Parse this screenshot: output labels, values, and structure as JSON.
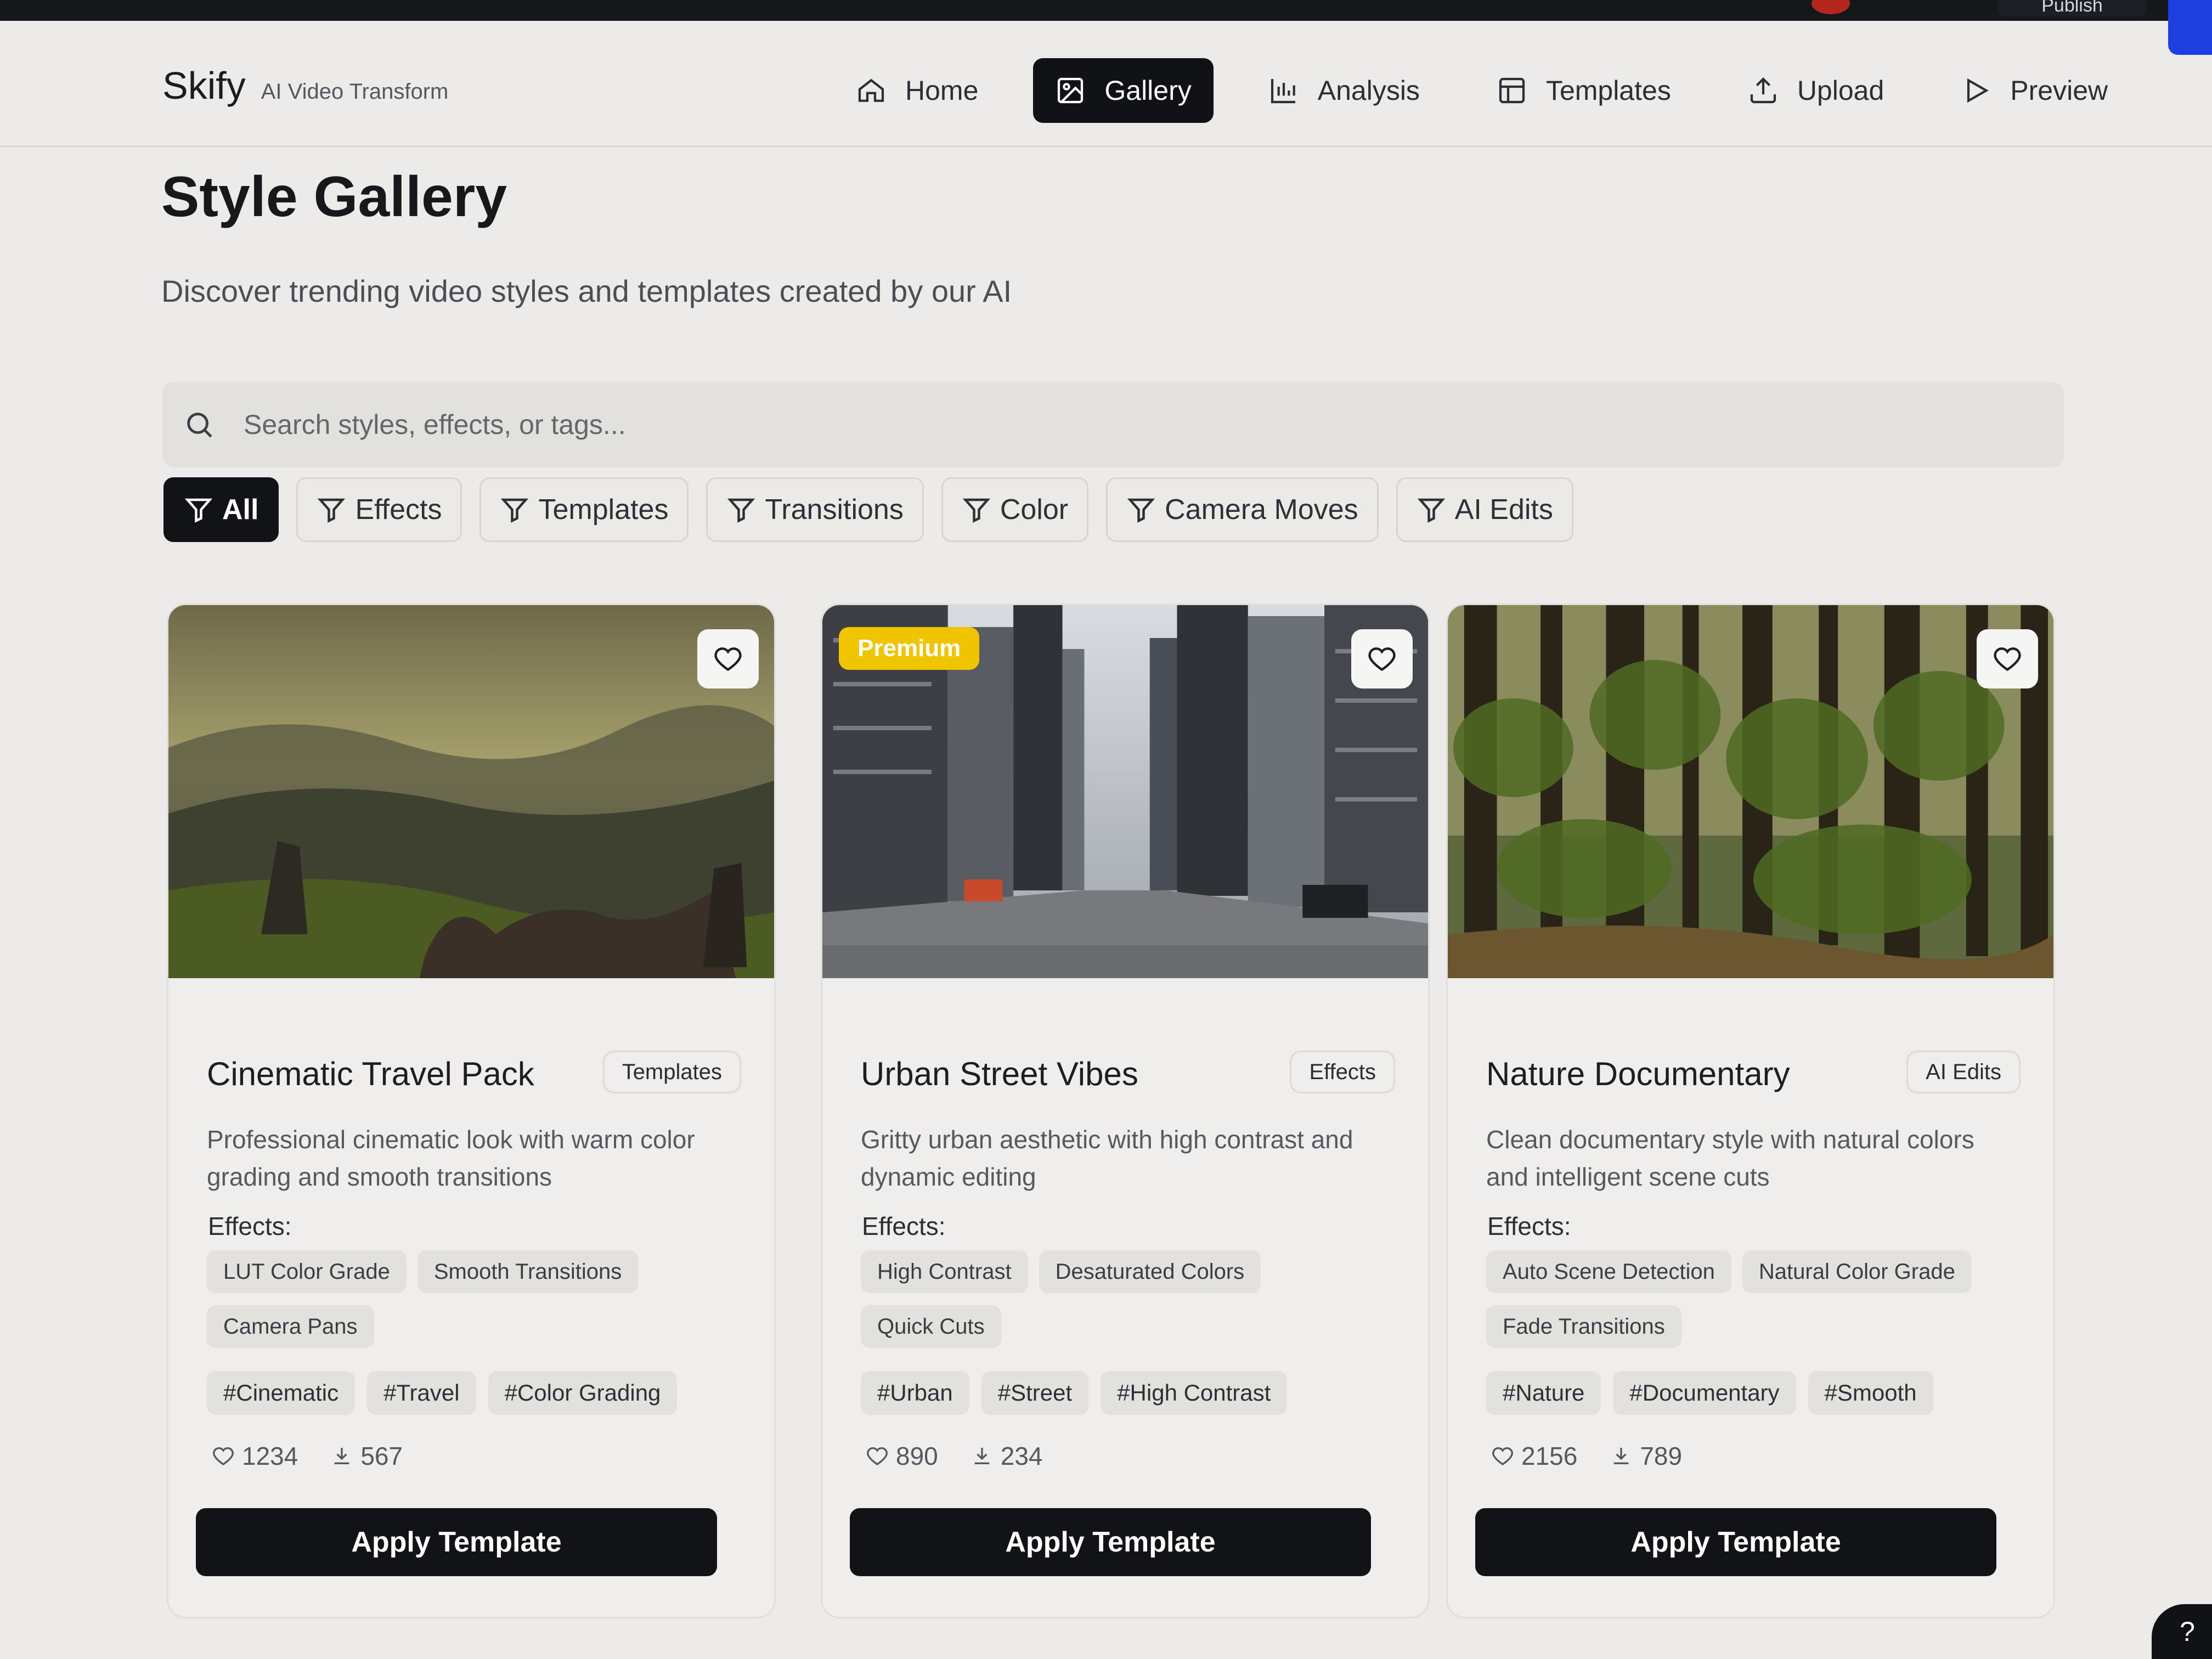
{
  "topbar": {
    "publish_label": "Publish"
  },
  "brand": {
    "name": "Skify",
    "tagline": "AI Video Transform"
  },
  "nav": [
    {
      "label": "Home",
      "icon": "home-icon",
      "active": false
    },
    {
      "label": "Gallery",
      "icon": "image-icon",
      "active": true
    },
    {
      "label": "Analysis",
      "icon": "bar-chart-icon",
      "active": false
    },
    {
      "label": "Templates",
      "icon": "layout-icon",
      "active": false
    },
    {
      "label": "Upload",
      "icon": "upload-icon",
      "active": false
    },
    {
      "label": "Preview",
      "icon": "play-icon",
      "active": false
    }
  ],
  "page": {
    "title": "Style Gallery",
    "subtitle": "Discover trending video styles and templates created by our AI"
  },
  "search": {
    "placeholder": "Search styles, effects, or tags...",
    "value": ""
  },
  "filters": [
    "All",
    "Effects",
    "Templates",
    "Transitions",
    "Color",
    "Camera Moves",
    "AI Edits"
  ],
  "active_filter": "All",
  "cards": [
    {
      "title": "Cinematic Travel Pack",
      "category": "Templates",
      "premium": false,
      "description": "Professional cinematic look with warm color grading and smooth transitions",
      "effects_label": "Effects:",
      "effects": [
        "LUT Color Grade",
        "Smooth Transitions",
        "Camera Pans"
      ],
      "tags": [
        "#Cinematic",
        "#Travel",
        "#Color Grading"
      ],
      "likes": "1234",
      "downloads": "567",
      "button": "Apply Template"
    },
    {
      "title": "Urban Street Vibes",
      "category": "Effects",
      "premium": true,
      "premium_label": "Premium",
      "description": "Gritty urban aesthetic with high contrast and dynamic editing",
      "effects_label": "Effects:",
      "effects": [
        "High Contrast",
        "Desaturated Colors",
        "Quick Cuts"
      ],
      "tags": [
        "#Urban",
        "#Street",
        "#High Contrast"
      ],
      "likes": "890",
      "downloads": "234",
      "button": "Apply Template"
    },
    {
      "title": "Nature Documentary",
      "category": "AI Edits",
      "premium": false,
      "description": "Clean documentary style with natural colors and intelligent scene cuts",
      "effects_label": "Effects:",
      "effects": [
        "Auto Scene Detection",
        "Natural Color Grade",
        "Fade Transitions"
      ],
      "tags": [
        "#Nature",
        "#Documentary",
        "#Smooth"
      ],
      "likes": "2156",
      "downloads": "789",
      "button": "Apply Template"
    }
  ],
  "help_label": "?",
  "colors": {
    "primary_dark": "#111317",
    "premium": "#f1c400",
    "background": "#ecebe9"
  }
}
